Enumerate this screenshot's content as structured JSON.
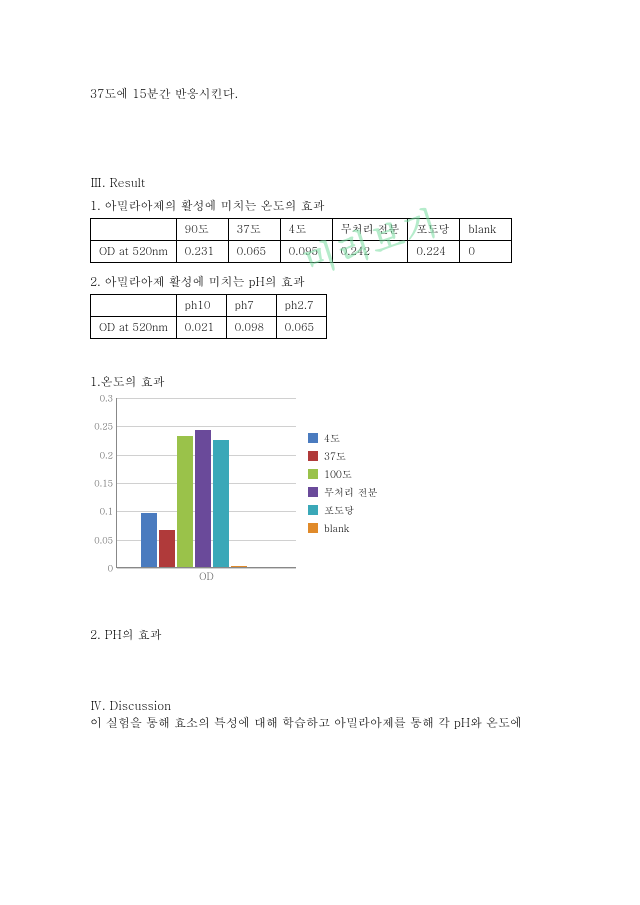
{
  "intro_line": "37도에 15분간 반응시킨다.",
  "result": {
    "heading": "Ⅲ. Result",
    "table1_title": "1. 아밀라아제의 활성에 미치는 온도의 효과",
    "table1_headers": [
      "",
      "90도",
      "37도",
      "4도",
      "무처리 전분",
      "포도당",
      "blank"
    ],
    "table1_rowlabel": "OD at 520nm",
    "table1_values": [
      "0.231",
      "0.065",
      "0.095",
      "0.242",
      "0.224",
      "0"
    ],
    "table2_title": "2. 아밀라아제 활성에 미치는 pH의 효과",
    "table2_headers": [
      "",
      "ph10",
      "ph7",
      "ph2.7"
    ],
    "table2_rowlabel": "OD at 520nm",
    "table2_values": [
      "0.021",
      "0.098",
      "0.065"
    ]
  },
  "chart1_title": "1.온도의 효과",
  "chart2_title": "2. PH의 효과",
  "discussion": {
    "heading": "Ⅳ. Discussion",
    "line1": " 이 실험을 통해 효소의 특성에 대해 학습하고 아밀라아제를 통해 각 pH와 온도에"
  },
  "watermark_text": "미리보기",
  "chart_data": {
    "type": "bar",
    "categories": [
      "4도",
      "37도",
      "100도",
      "무처리 전분",
      "포도당",
      "blank"
    ],
    "values": [
      0.095,
      0.065,
      0.231,
      0.242,
      0.224,
      0
    ],
    "colors": [
      "#4a7bbf",
      "#b03a3a",
      "#9ac24a",
      "#6a4a9a",
      "#3aa8b8",
      "#e08a2a"
    ],
    "xlabel": "OD",
    "ylim": [
      0,
      0.3
    ],
    "yticks": [
      0,
      0.05,
      0.1,
      0.15,
      0.2,
      0.25,
      0.3
    ]
  }
}
